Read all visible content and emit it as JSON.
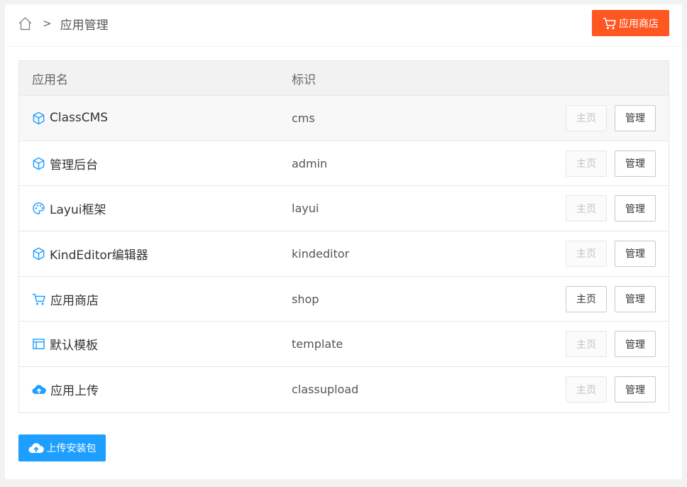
{
  "breadcrumb": {
    "separator": ">",
    "current": "应用管理"
  },
  "header": {
    "shop_button": "应用商店"
  },
  "table": {
    "headers": {
      "name": "应用名",
      "id": "标识"
    },
    "rows": [
      {
        "name": "ClassCMS",
        "id": "cms",
        "icon": "cube-icon",
        "home": "主页",
        "manage": "管理",
        "home_enabled": false
      },
      {
        "name": "管理后台",
        "id": "admin",
        "icon": "cube-icon",
        "home": "主页",
        "manage": "管理",
        "home_enabled": false
      },
      {
        "name": "Layui框架",
        "id": "layui",
        "icon": "palette-icon",
        "home": "主页",
        "manage": "管理",
        "home_enabled": false
      },
      {
        "name": "KindEditor编辑器",
        "id": "kindeditor",
        "icon": "cube-icon",
        "home": "主页",
        "manage": "管理",
        "home_enabled": false
      },
      {
        "name": "应用商店",
        "id": "shop",
        "icon": "cart-icon",
        "home": "主页",
        "manage": "管理",
        "home_enabled": true
      },
      {
        "name": "默认模板",
        "id": "template",
        "icon": "template-icon",
        "home": "主页",
        "manage": "管理",
        "home_enabled": false
      },
      {
        "name": "应用上传",
        "id": "classupload",
        "icon": "cloud-upload-icon",
        "home": "主页",
        "manage": "管理",
        "home_enabled": false
      }
    ]
  },
  "footer": {
    "upload_button": "上传安装包"
  },
  "colors": {
    "accent_orange": "#ff5722",
    "accent_blue": "#1e9fff",
    "icon_blue": "#1e9fff"
  }
}
